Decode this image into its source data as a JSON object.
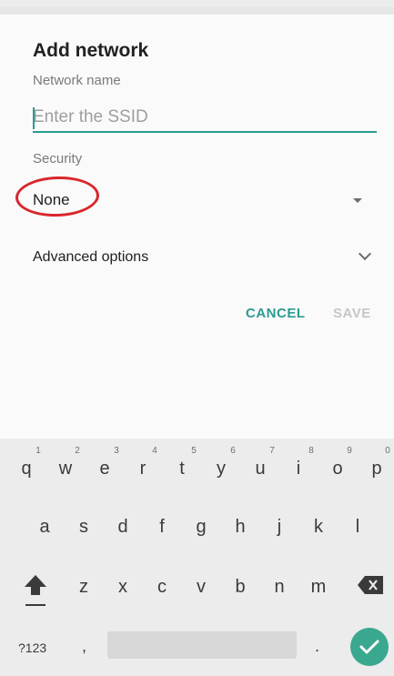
{
  "dialog": {
    "title": "Add network",
    "network_name_label": "Network name",
    "ssid_placeholder": "Enter the SSID",
    "security_label": "Security",
    "security_value": "None",
    "advanced_label": "Advanced options",
    "cancel_label": "CANCEL",
    "save_label": "SAVE"
  },
  "keyboard": {
    "row1": [
      "q",
      "w",
      "e",
      "r",
      "t",
      "y",
      "u",
      "i",
      "o",
      "p"
    ],
    "row1_hints": [
      "1",
      "2",
      "3",
      "4",
      "5",
      "6",
      "7",
      "8",
      "9",
      "0"
    ],
    "row2": [
      "a",
      "s",
      "d",
      "f",
      "g",
      "h",
      "j",
      "k",
      "l"
    ],
    "row3": [
      "z",
      "x",
      "c",
      "v",
      "b",
      "n",
      "m"
    ],
    "symbols_label": "?123",
    "comma": ",",
    "period": "."
  },
  "colors": {
    "accent": "#2a9d8f",
    "annotation": "#d9262c"
  }
}
